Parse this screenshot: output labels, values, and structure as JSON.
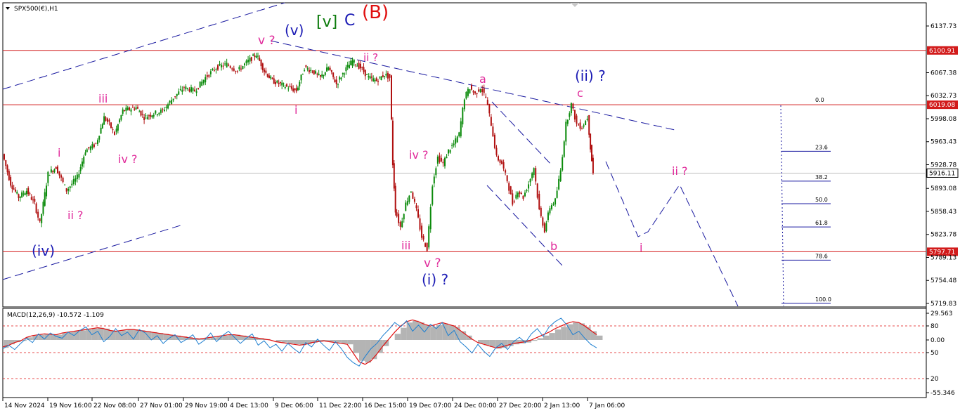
{
  "title": "SPX500(€),H1",
  "macd_label": "MACD(12,26,9) -10.572 -1.109",
  "colors": {
    "candle_up": "#0a8a0a",
    "candle_down": "#b01010",
    "hline": "#d21b1b",
    "trend": "#1a1aa0",
    "wave_magenta": "#e0299a",
    "wave_blue": "#1a1ab4",
    "wave_green": "#0a7a0a",
    "wave_red": "#e01010",
    "macd_hist": "#b4b4b4",
    "macd_signal": "#e01010",
    "macd_line": "#1e7fd0",
    "price_tag_bg": "#d21b1b"
  },
  "icons": {
    "menu": "triangle-down-icon"
  },
  "chart_data": {
    "type": "candlestick",
    "title": "SPX500(€),H1",
    "y_ticks": [
      "6137.73",
      "6067.38",
      "6032.73",
      "5998.08",
      "5963.43",
      "5928.78",
      "5893.08",
      "5858.43",
      "5823.78",
      "5789.13",
      "5754.48",
      "5719.83"
    ],
    "x_ticks": [
      "14 Nov 2024",
      "19 Nov 16:00",
      "22 Nov 08:00",
      "27 Nov 01:00",
      "29 Nov 19:00",
      "4 Dec 13:00",
      "9 Dec 06:00",
      "11 Dec 22:00",
      "16 Dec 15:00",
      "19 Dec 07:00",
      "24 Dec 00:00",
      "27 Dec 20:00",
      "2 Jan 13:00",
      "7 Jan 06:00"
    ],
    "ylim": [
      5719.83,
      6160
    ],
    "horizontal_levels": [
      {
        "value": 6100.91,
        "label": "6100.91"
      },
      {
        "value": 6019.08,
        "label": "6019.08"
      },
      {
        "value": 5797.71,
        "label": "5797.71"
      }
    ],
    "current_price": {
      "value": 5916.11,
      "label": "5916.11"
    },
    "fibonacci": {
      "levels": [
        {
          "label": "0.0",
          "value": 6019.08
        },
        {
          "label": "23.6",
          "value": 5949
        },
        {
          "label": "38.2",
          "value": 5904
        },
        {
          "label": "50.0",
          "value": 5870
        },
        {
          "label": "61.8",
          "value": 5835
        },
        {
          "label": "78.6",
          "value": 5785
        },
        {
          "label": "100.0",
          "value": 5720
        }
      ]
    },
    "price_path": [
      {
        "x": 0,
        "y": 5945
      },
      {
        "x": 3,
        "y": 5900
      },
      {
        "x": 6,
        "y": 5880
      },
      {
        "x": 9,
        "y": 5890
      },
      {
        "x": 12,
        "y": 5870
      },
      {
        "x": 14,
        "y": 5840
      },
      {
        "x": 17,
        "y": 5915
      },
      {
        "x": 20,
        "y": 5925
      },
      {
        "x": 24,
        "y": 5890
      },
      {
        "x": 28,
        "y": 5910
      },
      {
        "x": 31,
        "y": 5950
      },
      {
        "x": 35,
        "y": 5960
      },
      {
        "x": 38,
        "y": 6000
      },
      {
        "x": 40,
        "y": 5990
      },
      {
        "x": 42,
        "y": 5975
      },
      {
        "x": 45,
        "y": 6010
      },
      {
        "x": 50,
        "y": 6015
      },
      {
        "x": 53,
        "y": 6000
      },
      {
        "x": 56,
        "y": 6005
      },
      {
        "x": 60,
        "y": 6010
      },
      {
        "x": 64,
        "y": 6030
      },
      {
        "x": 68,
        "y": 6045
      },
      {
        "x": 72,
        "y": 6040
      },
      {
        "x": 76,
        "y": 6060
      },
      {
        "x": 80,
        "y": 6075
      },
      {
        "x": 84,
        "y": 6080
      },
      {
        "x": 88,
        "y": 6070
      },
      {
        "x": 92,
        "y": 6085
      },
      {
        "x": 95,
        "y": 6095
      },
      {
        "x": 98,
        "y": 6070
      },
      {
        "x": 101,
        "y": 6055
      },
      {
        "x": 104,
        "y": 6050
      },
      {
        "x": 107,
        "y": 6045
      },
      {
        "x": 110,
        "y": 6040
      },
      {
        "x": 113,
        "y": 6075
      },
      {
        "x": 116,
        "y": 6070
      },
      {
        "x": 119,
        "y": 6060
      },
      {
        "x": 122,
        "y": 6075
      },
      {
        "x": 125,
        "y": 6050
      },
      {
        "x": 128,
        "y": 6070
      },
      {
        "x": 131,
        "y": 6085
      },
      {
        "x": 134,
        "y": 6075
      },
      {
        "x": 137,
        "y": 6060
      },
      {
        "x": 140,
        "y": 6055
      },
      {
        "x": 143,
        "y": 6065
      },
      {
        "x": 145,
        "y": 6060
      },
      {
        "x": 146,
        "y": 5930
      },
      {
        "x": 147,
        "y": 5860
      },
      {
        "x": 149,
        "y": 5835
      },
      {
        "x": 151,
        "y": 5870
      },
      {
        "x": 153,
        "y": 5890
      },
      {
        "x": 155,
        "y": 5860
      },
      {
        "x": 157,
        "y": 5820
      },
      {
        "x": 159,
        "y": 5802
      },
      {
        "x": 161,
        "y": 5900
      },
      {
        "x": 163,
        "y": 5940
      },
      {
        "x": 165,
        "y": 5930
      },
      {
        "x": 167,
        "y": 5950
      },
      {
        "x": 169,
        "y": 5960
      },
      {
        "x": 171,
        "y": 5975
      },
      {
        "x": 173,
        "y": 6030
      },
      {
        "x": 175,
        "y": 6045
      },
      {
        "x": 177,
        "y": 6035
      },
      {
        "x": 179,
        "y": 6045
      },
      {
        "x": 181,
        "y": 6030
      },
      {
        "x": 183,
        "y": 5990
      },
      {
        "x": 185,
        "y": 5940
      },
      {
        "x": 187,
        "y": 5930
      },
      {
        "x": 189,
        "y": 5905
      },
      {
        "x": 191,
        "y": 5870
      },
      {
        "x": 193,
        "y": 5890
      },
      {
        "x": 195,
        "y": 5880
      },
      {
        "x": 197,
        "y": 5900
      },
      {
        "x": 199,
        "y": 5925
      },
      {
        "x": 201,
        "y": 5860
      },
      {
        "x": 203,
        "y": 5830
      },
      {
        "x": 205,
        "y": 5865
      },
      {
        "x": 207,
        "y": 5875
      },
      {
        "x": 209,
        "y": 5920
      },
      {
        "x": 211,
        "y": 5990
      },
      {
        "x": 213,
        "y": 6020
      },
      {
        "x": 215,
        "y": 5990
      },
      {
        "x": 217,
        "y": 5985
      },
      {
        "x": 219,
        "y": 6000
      },
      {
        "x": 220,
        "y": 5955
      },
      {
        "x": 221,
        "y": 5916
      }
    ],
    "x_max": 340,
    "macd": {
      "ylim_labels": [
        "29.563",
        "80",
        "0.00",
        "50",
        "20",
        "-55.346"
      ],
      "hist": [
        -18,
        -10,
        -5,
        -2,
        6,
        10,
        12,
        14,
        13,
        12,
        16,
        18,
        20,
        22,
        24,
        26,
        28,
        26,
        22,
        20,
        22,
        24,
        24,
        22,
        20,
        18,
        16,
        14,
        12,
        10,
        8,
        6,
        4,
        2,
        4,
        6,
        8,
        10,
        12,
        12,
        10,
        8,
        6,
        4,
        2,
        0,
        -4,
        -6,
        -8,
        -10,
        -12,
        -10,
        -6,
        -4,
        -2,
        -4,
        -6,
        -8,
        -10,
        -30,
        -48,
        -52,
        -44,
        -30,
        -14,
        0,
        14,
        28,
        40,
        44,
        40,
        34,
        30,
        34,
        38,
        34,
        30,
        20,
        10,
        0,
        -8,
        -12,
        -16,
        -20,
        -18,
        -14,
        -10,
        -8,
        -6,
        -2,
        4,
        10,
        16,
        24,
        30,
        36,
        40,
        38,
        30,
        20,
        10
      ],
      "signal": [
        -16,
        -12,
        -6,
        -2,
        6,
        10,
        12,
        14,
        13,
        12,
        16,
        18,
        20,
        22,
        24,
        26,
        28,
        26,
        22,
        20,
        22,
        24,
        24,
        22,
        20,
        18,
        16,
        14,
        12,
        10,
        8,
        6,
        4,
        2,
        4,
        6,
        8,
        10,
        12,
        12,
        10,
        8,
        6,
        4,
        2,
        0,
        -4,
        -6,
        -8,
        -10,
        -12,
        -10,
        -6,
        -4,
        -2,
        -4,
        -6,
        -8,
        -10,
        -30,
        -50,
        -56,
        -48,
        -32,
        -14,
        2,
        18,
        32,
        42,
        46,
        42,
        36,
        32,
        36,
        40,
        36,
        32,
        22,
        12,
        2,
        -6,
        -10,
        -14,
        -18,
        -16,
        -12,
        -8,
        -6,
        -4,
        0,
        6,
        12,
        18,
        26,
        32,
        38,
        42,
        40,
        32,
        22,
        12
      ],
      "main": [
        -20,
        -12,
        -22,
        -8,
        4,
        -6,
        14,
        2,
        16,
        8,
        4,
        18,
        10,
        22,
        30,
        12,
        20,
        -4,
        8,
        26,
        10,
        18,
        2,
        24,
        16,
        0,
        10,
        -8,
        4,
        12,
        -6,
        2,
        12,
        -10,
        0,
        16,
        -4,
        10,
        20,
        6,
        -8,
        4,
        14,
        -12,
        -2,
        -18,
        -10,
        -26,
        -8,
        -20,
        -30,
        -6,
        -16,
        2,
        -12,
        -24,
        -4,
        -20,
        -40,
        -52,
        -60,
        -38,
        -20,
        -8,
        10,
        24,
        40,
        30,
        44,
        20,
        34,
        18,
        36,
        26,
        40,
        10,
        22,
        -4,
        -16,
        -30,
        -10,
        -26,
        -38,
        -18,
        -8,
        -22,
        -4,
        6,
        -6,
        14,
        26,
        8,
        30,
        42,
        50,
        34,
        12,
        20,
        4,
        -10,
        -18
      ]
    }
  },
  "waves": [
    {
      "text": "[v]",
      "color": "wave_green"
    },
    {
      "text": "C",
      "color": "wave_blue"
    },
    {
      "text": "(B)",
      "color": "wave_red"
    },
    {
      "text": "(v)",
      "color": "wave_blue"
    },
    {
      "text": "v ?",
      "color": "wave_magenta"
    },
    {
      "text": "ii ?",
      "color": "wave_magenta"
    },
    {
      "text": "iii",
      "color": "wave_magenta"
    },
    {
      "text": "i",
      "color": "wave_magenta"
    },
    {
      "text": "i",
      "color": "wave_magenta"
    },
    {
      "text": "iv ?",
      "color": "wave_magenta"
    },
    {
      "text": "ii ?",
      "color": "wave_magenta"
    },
    {
      "text": "(iv)",
      "color": "wave_blue"
    },
    {
      "text": "iv ?",
      "color": "wave_magenta"
    },
    {
      "text": "iii",
      "color": "wave_magenta"
    },
    {
      "text": "v ?",
      "color": "wave_magenta"
    },
    {
      "text": "(i) ?",
      "color": "wave_blue"
    },
    {
      "text": "a",
      "color": "wave_magenta"
    },
    {
      "text": "b",
      "color": "wave_magenta"
    },
    {
      "text": "(ii) ?",
      "color": "wave_blue"
    },
    {
      "text": "c",
      "color": "wave_magenta"
    },
    {
      "text": "ii ?",
      "color": "wave_magenta"
    },
    {
      "text": "i",
      "color": "wave_magenta"
    }
  ]
}
